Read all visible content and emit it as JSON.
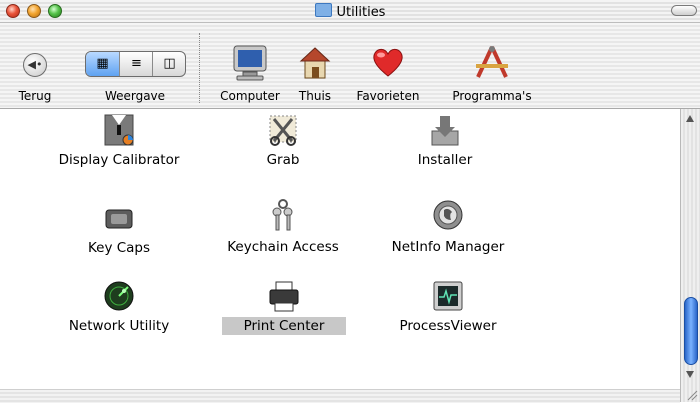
{
  "window": {
    "title": "Utilities"
  },
  "toolbar": {
    "back_label": "Terug",
    "view_label": "Weergave",
    "computer_label": "Computer",
    "home_label": "Thuis",
    "favorites_label": "Favorieten",
    "applications_label": "Programma's"
  },
  "items": [
    {
      "label": "Display Calibrator",
      "icon": "display-calibrator-icon"
    },
    {
      "label": "Grab",
      "icon": "grab-icon"
    },
    {
      "label": "Installer",
      "icon": "installer-icon"
    },
    {
      "label": "Key Caps",
      "icon": "key-caps-icon"
    },
    {
      "label": "Keychain Access",
      "icon": "keychain-access-icon"
    },
    {
      "label": "NetInfo Manager",
      "icon": "netinfo-manager-icon"
    },
    {
      "label": "Network Utility",
      "icon": "network-utility-icon"
    },
    {
      "label": "Print Center",
      "icon": "print-center-icon",
      "selected": true
    },
    {
      "label": "ProcessViewer",
      "icon": "process-viewer-icon"
    }
  ]
}
